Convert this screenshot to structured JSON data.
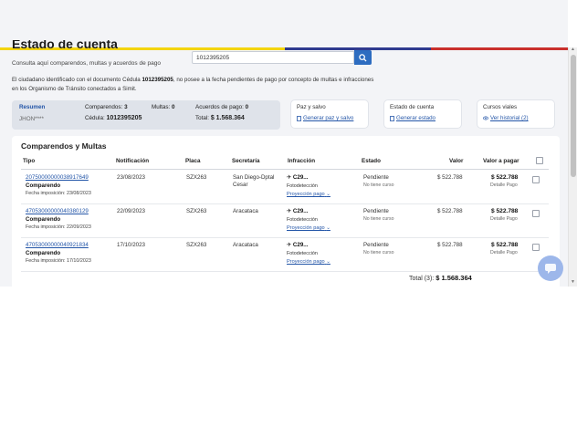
{
  "header": {
    "title": "Estado de cuenta",
    "subtitle": "Consulta aquí comparendos, multas y acuerdos de pago"
  },
  "search": {
    "value": "1012395205"
  },
  "notice": {
    "prefix": "El ciudadano identificado con el documento",
    "doc_type": "Cédula",
    "doc_number": "1012395205",
    "suffix": ", no posee a la fecha pendientes de pago por concepto de multas e infracciones en los Organismo de Tránsito conectados a Simit."
  },
  "summary": {
    "heading": "Resumen",
    "name": "JHON****",
    "comparendos_label": "Comparendos:",
    "comparendos_value": "3",
    "multas_label": "Multas:",
    "multas_value": "0",
    "acuerdos_label": "Acuerdos de pago:",
    "acuerdos_value": "0",
    "cedula_label": "Cédula:",
    "cedula_value": "1012395205",
    "total_label": "Total:",
    "total_value": "$ 1.568.364"
  },
  "cards": [
    {
      "title": "Paz y salvo",
      "link": "Generar paz y salvo",
      "icon": "document-icon"
    },
    {
      "title": "Estado de cuenta",
      "link": "Generar estado",
      "icon": "document-icon"
    },
    {
      "title": "Cursos viales",
      "link": "Ver historial (2)",
      "icon": "eye-icon"
    }
  ],
  "table": {
    "title": "Comparendos y Multas",
    "headers": [
      "Tipo",
      "Notificación",
      "Placa",
      "Secretaría",
      "Infracción",
      "Estado",
      "Valor",
      "Valor a pagar"
    ],
    "rows": [
      {
        "number": "20750000000038917649",
        "type": "Comparendo",
        "fecha": "Fecha imposición: 23/08/2023",
        "notificacion": "23/08/2023",
        "placa": "SZX263",
        "secretaria_1": "San Diego-Dptal",
        "secretaria_2": "Cesar",
        "infraccion": "C29...",
        "medio": "Fotodetección",
        "proyeccion": "Proyección pago",
        "estado": "Pendiente",
        "curso": "No tiene curso",
        "valor": "$ 522.788",
        "valor_pagar": "$ 522.788",
        "detalle": "Detalle Pago"
      },
      {
        "number": "47053000000040380129",
        "type": "Comparendo",
        "fecha": "Fecha imposición: 22/09/2023",
        "notificacion": "22/09/2023",
        "placa": "SZX263",
        "secretaria_1": "Aracataca",
        "secretaria_2": "",
        "infraccion": "C29...",
        "medio": "Fotodetección",
        "proyeccion": "Proyección pago",
        "estado": "Pendiente",
        "curso": "No tiene curso",
        "valor": "$ 522.788",
        "valor_pagar": "$ 522.788",
        "detalle": "Detalle Pago"
      },
      {
        "number": "47053000000040921834",
        "type": "Comparendo",
        "fecha": "Fecha imposición: 17/10/2023",
        "notificacion": "17/10/2023",
        "placa": "SZX263",
        "secretaria_1": "Aracataca",
        "secretaria_2": "",
        "infraccion": "C29...",
        "medio": "Fotodetección",
        "proyeccion": "Proyección pago",
        "estado": "Pendiente",
        "curso": "No tiene curso",
        "valor": "$ 522.788",
        "valor_pagar": "$ 522.788",
        "detalle": "Detalle Pago"
      }
    ],
    "total_label": "Total (3):",
    "total_value": "$ 1.568.364"
  },
  "colors": {
    "accent": "#2d6cc0",
    "link": "#2456a8",
    "flag_yellow": "#f3d40f",
    "flag_blue": "#2f3a8f",
    "flag_red": "#c9302c"
  }
}
